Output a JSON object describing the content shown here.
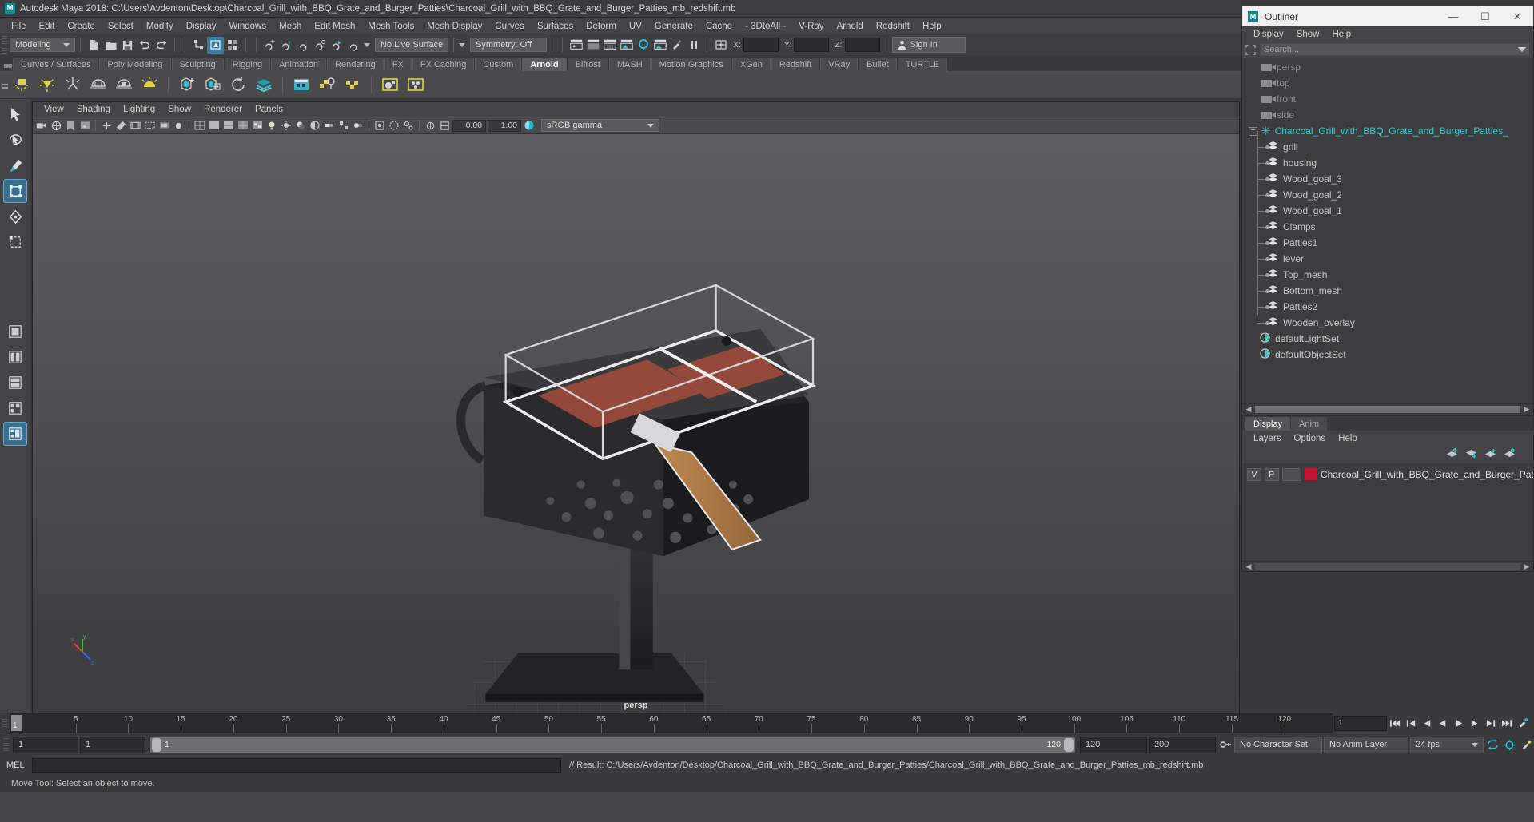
{
  "window": {
    "title": "Autodesk Maya 2018: C:\\Users\\Avdenton\\Desktop\\Charcoal_Grill_with_BBQ_Grate_and_Burger_Patties\\Charcoal_Grill_with_BBQ_Grate_and_Burger_Patties_mb_redshift.mb",
    "logo": "M"
  },
  "menubar": {
    "items": [
      "File",
      "Edit",
      "Create",
      "Select",
      "Modify",
      "Display",
      "Windows",
      "Mesh",
      "Edit Mesh",
      "Mesh Tools",
      "Mesh Display",
      "Curves",
      "Surfaces",
      "Deform",
      "UV",
      "Generate",
      "Cache",
      "- 3DtoAll -",
      "V-Ray",
      "Arnold",
      "Redshift",
      "Help"
    ]
  },
  "statusline": {
    "menuset": "Modeling",
    "live_surface": "No Live Surface",
    "symmetry": "Symmetry: Off",
    "x_label": "X:",
    "y_label": "Y:",
    "z_label": "Z:",
    "x_value": "",
    "y_value": "",
    "z_value": "",
    "signin": "Sign In"
  },
  "shelf": {
    "tabs": [
      "Curves / Surfaces",
      "Poly Modeling",
      "Sculpting",
      "Rigging",
      "Animation",
      "Rendering",
      "FX",
      "FX Caching",
      "Custom",
      "Arnold",
      "Bifrost",
      "MASH",
      "Motion Graphics",
      "XGen",
      "Redshift",
      "VRay",
      "Bullet",
      "TURTLE"
    ],
    "selected_tab": "Arnold"
  },
  "viewport": {
    "menu": [
      "View",
      "Shading",
      "Lighting",
      "Show",
      "Renderer",
      "Panels"
    ],
    "exposure": "0.00",
    "gamma": "1.00",
    "colorspace": "sRGB gamma",
    "camera_label": "persp",
    "axis": {
      "x": "x",
      "y": "y",
      "z": "z"
    }
  },
  "outliner": {
    "title": "Outliner",
    "logo": "M",
    "menu": [
      "Display",
      "Show",
      "Help"
    ],
    "search_placeholder": "Search...",
    "items": [
      {
        "label": "persp",
        "type": "camera",
        "depth": 0
      },
      {
        "label": "top",
        "type": "camera",
        "depth": 0
      },
      {
        "label": "front",
        "type": "camera",
        "depth": 0
      },
      {
        "label": "side",
        "type": "camera",
        "depth": 0
      },
      {
        "label": "Charcoal_Grill_with_BBQ_Grate_and_Burger_Patties_",
        "type": "group",
        "depth": 0
      },
      {
        "label": "grill",
        "type": "mesh",
        "depth": 1
      },
      {
        "label": "housing",
        "type": "mesh",
        "depth": 1
      },
      {
        "label": "Wood_goal_3",
        "type": "mesh",
        "depth": 1
      },
      {
        "label": "Wood_goal_2",
        "type": "mesh",
        "depth": 1
      },
      {
        "label": "Wood_goal_1",
        "type": "mesh",
        "depth": 1
      },
      {
        "label": "Clamps",
        "type": "mesh",
        "depth": 1
      },
      {
        "label": "Patties1",
        "type": "mesh",
        "depth": 1
      },
      {
        "label": "lever",
        "type": "mesh",
        "depth": 1
      },
      {
        "label": "Top_mesh",
        "type": "mesh",
        "depth": 1
      },
      {
        "label": "Bottom_mesh",
        "type": "mesh",
        "depth": 1
      },
      {
        "label": "Patties2",
        "type": "mesh",
        "depth": 1
      },
      {
        "label": "Wooden_overlay",
        "type": "mesh",
        "depth": 1
      },
      {
        "label": "defaultLightSet",
        "type": "set",
        "depth": 0
      },
      {
        "label": "defaultObjectSet",
        "type": "set",
        "depth": 0
      }
    ],
    "window_buttons": {
      "minimize": "—",
      "maximize": "☐",
      "close": "✕"
    }
  },
  "layers": {
    "tabs": [
      "Display",
      "Anim"
    ],
    "selected_tab": "Display",
    "menu": [
      "Layers",
      "Options",
      "Help"
    ],
    "columns": {
      "v": "V",
      "p": "P"
    },
    "rows": [
      {
        "v": "V",
        "p": "P",
        "color": "#c01432",
        "name": "Charcoal_Grill_with_BBQ_Grate_and_Burger_Patties"
      }
    ]
  },
  "timeline": {
    "ticks": [
      5,
      10,
      15,
      20,
      25,
      30,
      35,
      40,
      45,
      50,
      55,
      60,
      65,
      70,
      75,
      80,
      85,
      90,
      95,
      100,
      105,
      110,
      115,
      120
    ],
    "current_frame": "1",
    "end_field": "1"
  },
  "range": {
    "start_field": "1",
    "current_field": "1",
    "range_start": "1",
    "range_end": "120",
    "anim_start": "120",
    "anim_end": "200",
    "character_set": "No Character Set",
    "anim_layer": "No Anim Layer",
    "fps": "24 fps"
  },
  "command": {
    "mel_label": "MEL",
    "input_value": "",
    "result": "// Result: C:/Users/Avdenton/Desktop/Charcoal_Grill_with_BBQ_Grate_and_Burger_Patties/Charcoal_Grill_with_BBQ_Grate_and_Burger_Patties_mb_redshift.mb"
  },
  "helpline": {
    "text": "Move Tool: Select an object to move."
  },
  "colors": {
    "accent_teal": "#2fd0d0",
    "selection_blue": "#3c7a9e",
    "shelf_yellow": "#e0d040",
    "layer_red": "#c01432"
  }
}
